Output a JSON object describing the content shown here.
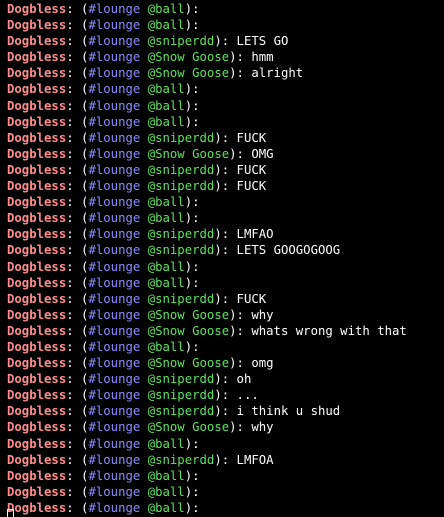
{
  "colors": {
    "background": "#000000",
    "nick": "#ff8c8c",
    "channel": "#8c8cff",
    "target": "#60e060",
    "text": "#ffffff"
  },
  "lines": [
    {
      "nick": "Dogbless",
      "channel": "#lounge",
      "target": "@ball",
      "message": ""
    },
    {
      "nick": "Dogbless",
      "channel": "#lounge",
      "target": "@ball",
      "message": ""
    },
    {
      "nick": "Dogbless",
      "channel": "#lounge",
      "target": "@sniperdd",
      "message": "LETS GO"
    },
    {
      "nick": "Dogbless",
      "channel": "#lounge",
      "target": "@Snow Goose",
      "message": "hmm"
    },
    {
      "nick": "Dogbless",
      "channel": "#lounge",
      "target": "@Snow Goose",
      "message": "alright"
    },
    {
      "nick": "Dogbless",
      "channel": "#lounge",
      "target": "@ball",
      "message": ""
    },
    {
      "nick": "Dogbless",
      "channel": "#lounge",
      "target": "@ball",
      "message": ""
    },
    {
      "nick": "Dogbless",
      "channel": "#lounge",
      "target": "@ball",
      "message": ""
    },
    {
      "nick": "Dogbless",
      "channel": "#lounge",
      "target": "@sniperdd",
      "message": "FUCK"
    },
    {
      "nick": "Dogbless",
      "channel": "#lounge",
      "target": "@Snow Goose",
      "message": "OMG"
    },
    {
      "nick": "Dogbless",
      "channel": "#lounge",
      "target": "@sniperdd",
      "message": "FUCK"
    },
    {
      "nick": "Dogbless",
      "channel": "#lounge",
      "target": "@sniperdd",
      "message": "FUCK"
    },
    {
      "nick": "Dogbless",
      "channel": "#lounge",
      "target": "@ball",
      "message": ""
    },
    {
      "nick": "Dogbless",
      "channel": "#lounge",
      "target": "@ball",
      "message": ""
    },
    {
      "nick": "Dogbless",
      "channel": "#lounge",
      "target": "@sniperdd",
      "message": "LMFAO"
    },
    {
      "nick": "Dogbless",
      "channel": "#lounge",
      "target": "@sniperdd",
      "message": "LETS GOOGOGOOG"
    },
    {
      "nick": "Dogbless",
      "channel": "#lounge",
      "target": "@ball",
      "message": ""
    },
    {
      "nick": "Dogbless",
      "channel": "#lounge",
      "target": "@ball",
      "message": ""
    },
    {
      "nick": "Dogbless",
      "channel": "#lounge",
      "target": "@sniperdd",
      "message": "FUCK"
    },
    {
      "nick": "Dogbless",
      "channel": "#lounge",
      "target": "@Snow Goose",
      "message": "why"
    },
    {
      "nick": "Dogbless",
      "channel": "#lounge",
      "target": "@Snow Goose",
      "message": "whats wrong with that"
    },
    {
      "nick": "Dogbless",
      "channel": "#lounge",
      "target": "@ball",
      "message": ""
    },
    {
      "nick": "Dogbless",
      "channel": "#lounge",
      "target": "@Snow Goose",
      "message": "omg"
    },
    {
      "nick": "Dogbless",
      "channel": "#lounge",
      "target": "@sniperdd",
      "message": "oh"
    },
    {
      "nick": "Dogbless",
      "channel": "#lounge",
      "target": "@sniperdd",
      "message": "..."
    },
    {
      "nick": "Dogbless",
      "channel": "#lounge",
      "target": "@sniperdd",
      "message": "i think u shud"
    },
    {
      "nick": "Dogbless",
      "channel": "#lounge",
      "target": "@Snow Goose",
      "message": "why"
    },
    {
      "nick": "Dogbless",
      "channel": "#lounge",
      "target": "@ball",
      "message": ""
    },
    {
      "nick": "Dogbless",
      "channel": "#lounge",
      "target": "@sniperdd",
      "message": "LMFOA"
    },
    {
      "nick": "Dogbless",
      "channel": "#lounge",
      "target": "@ball",
      "message": ""
    },
    {
      "nick": "Dogbless",
      "channel": "#lounge",
      "target": "@ball",
      "message": ""
    },
    {
      "nick": "Dogbless",
      "channel": "#lounge",
      "target": "@ball",
      "message": ""
    }
  ],
  "cursor_icon": "block-cursor"
}
